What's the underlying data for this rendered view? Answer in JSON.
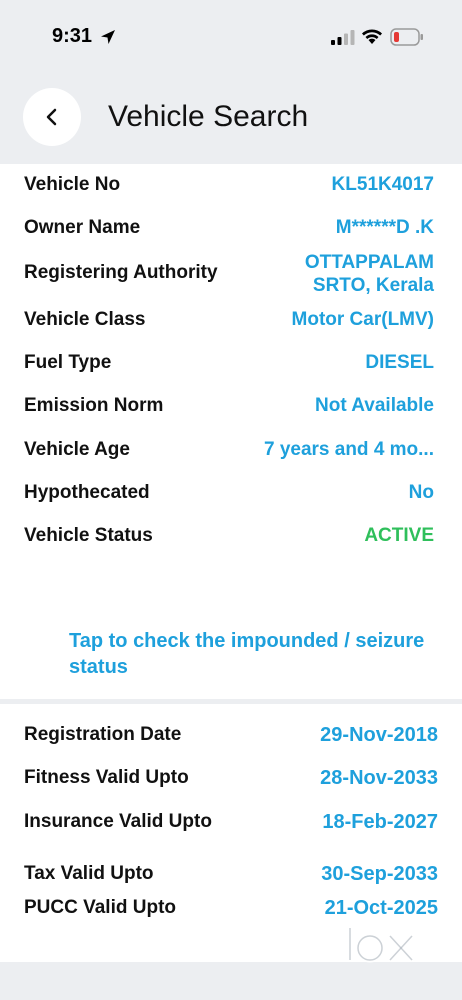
{
  "status_bar": {
    "time": "9:31"
  },
  "header": {
    "title": "Vehicle Search"
  },
  "vehicle_details": [
    {
      "label": "Vehicle No",
      "value": "KL51K4017"
    },
    {
      "label": "Owner Name",
      "value": "M******D .K"
    },
    {
      "label": "Registering Authority",
      "value": "OTTAPPALAM SRTO, Kerala"
    },
    {
      "label": "Vehicle Class",
      "value": "Motor Car(LMV)"
    },
    {
      "label": "Fuel Type",
      "value": "DIESEL"
    },
    {
      "label": "Emission Norm",
      "value": "Not Available"
    },
    {
      "label": "Vehicle Age",
      "value": "7 years and 4 mo..."
    },
    {
      "label": "Hypothecated",
      "value": "No"
    },
    {
      "label": "Vehicle Status",
      "value": "ACTIVE"
    }
  ],
  "impound_link": "Tap to check the impounded / seizure status",
  "validity_details": [
    {
      "label": "Registration Date",
      "value": "29-Nov-2018"
    },
    {
      "label": "Fitness Valid Upto",
      "value": "28-Nov-2033"
    },
    {
      "label": "Insurance Valid Upto",
      "value": "18-Feb-2027"
    },
    {
      "label": "Tax Valid Upto",
      "value": "30-Sep-2033"
    },
    {
      "label": "PUCC Valid Upto",
      "value": "21-Oct-2025"
    }
  ],
  "colors": {
    "accent": "#1ea0dc",
    "active_status": "#2fbf5b",
    "background": "#eceef1"
  }
}
